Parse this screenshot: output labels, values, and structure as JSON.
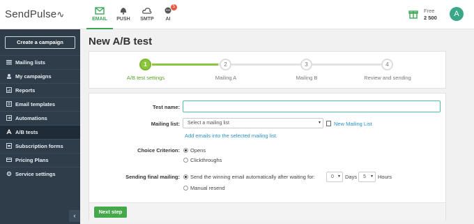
{
  "brand": {
    "name": "SendPulse",
    "wave": "∿"
  },
  "toolbar": {
    "tabs": [
      {
        "label": "EMAIL",
        "icon": "envelope-icon",
        "active": true
      },
      {
        "label": "PUSH",
        "icon": "bell-icon"
      },
      {
        "label": "SMTP",
        "icon": "cloud-icon"
      },
      {
        "label": "AI",
        "icon": "robot-icon",
        "badge": "5"
      }
    ],
    "gift_icon": "gift-icon",
    "plan_name": "Free",
    "plan_count": "2 500",
    "avatar_letter": "A"
  },
  "sidebar": {
    "create_label": "Create a campaign",
    "items": [
      {
        "label": "Mailing lists",
        "icon": "list-icon"
      },
      {
        "label": "My campaigns",
        "icon": "campaign-icon"
      },
      {
        "label": "Reports",
        "icon": "chart-icon"
      },
      {
        "label": "Email templates",
        "icon": "template-icon"
      },
      {
        "label": "Automations",
        "icon": "automation-icon"
      },
      {
        "label": "A/B tests",
        "icon": "ab-icon",
        "active": true
      },
      {
        "label": "Subscription forms",
        "icon": "form-icon"
      },
      {
        "label": "Pricing Plans",
        "icon": "pricing-icon"
      },
      {
        "label": "Service settings",
        "icon": "settings-icon"
      }
    ],
    "collapse_glyph": "‹"
  },
  "page": {
    "title": "New A/B test"
  },
  "steps": [
    {
      "num": "1",
      "label": "A/B test settings",
      "active": true
    },
    {
      "num": "2",
      "label": "Mailing A"
    },
    {
      "num": "3",
      "label": "Mailing B"
    },
    {
      "num": "4",
      "label": "Review and sending"
    }
  ],
  "form": {
    "test_name_label": "Test name:",
    "test_name_value": "",
    "mailing_list_label": "Mailing list:",
    "mailing_list_placeholder": "Select a mailing list",
    "new_list_link": "New Mailing List",
    "add_emails_link": "Add emails into the selected mailing list.",
    "choice_label": "Choice Criterion:",
    "choice_options": [
      "Opens",
      "Clickthroughs"
    ],
    "choice_selected": 0,
    "sending_label": "Sending final mailing:",
    "sending_auto_text": "Send the winning email automatically after waiting for:",
    "days_value": "0",
    "days_label": "Days",
    "hours_value": "5",
    "hours_label": "Hours",
    "sending_manual_text": "Manual resend",
    "sending_selected": 0,
    "caret_glyph": "▾"
  },
  "footer": {
    "next_label": "Next step"
  },
  "colors": {
    "accent": "#3aa755",
    "sidebar_bg": "#2f3d4a",
    "step_green": "#8cc63f",
    "link": "#2a8fc7"
  }
}
